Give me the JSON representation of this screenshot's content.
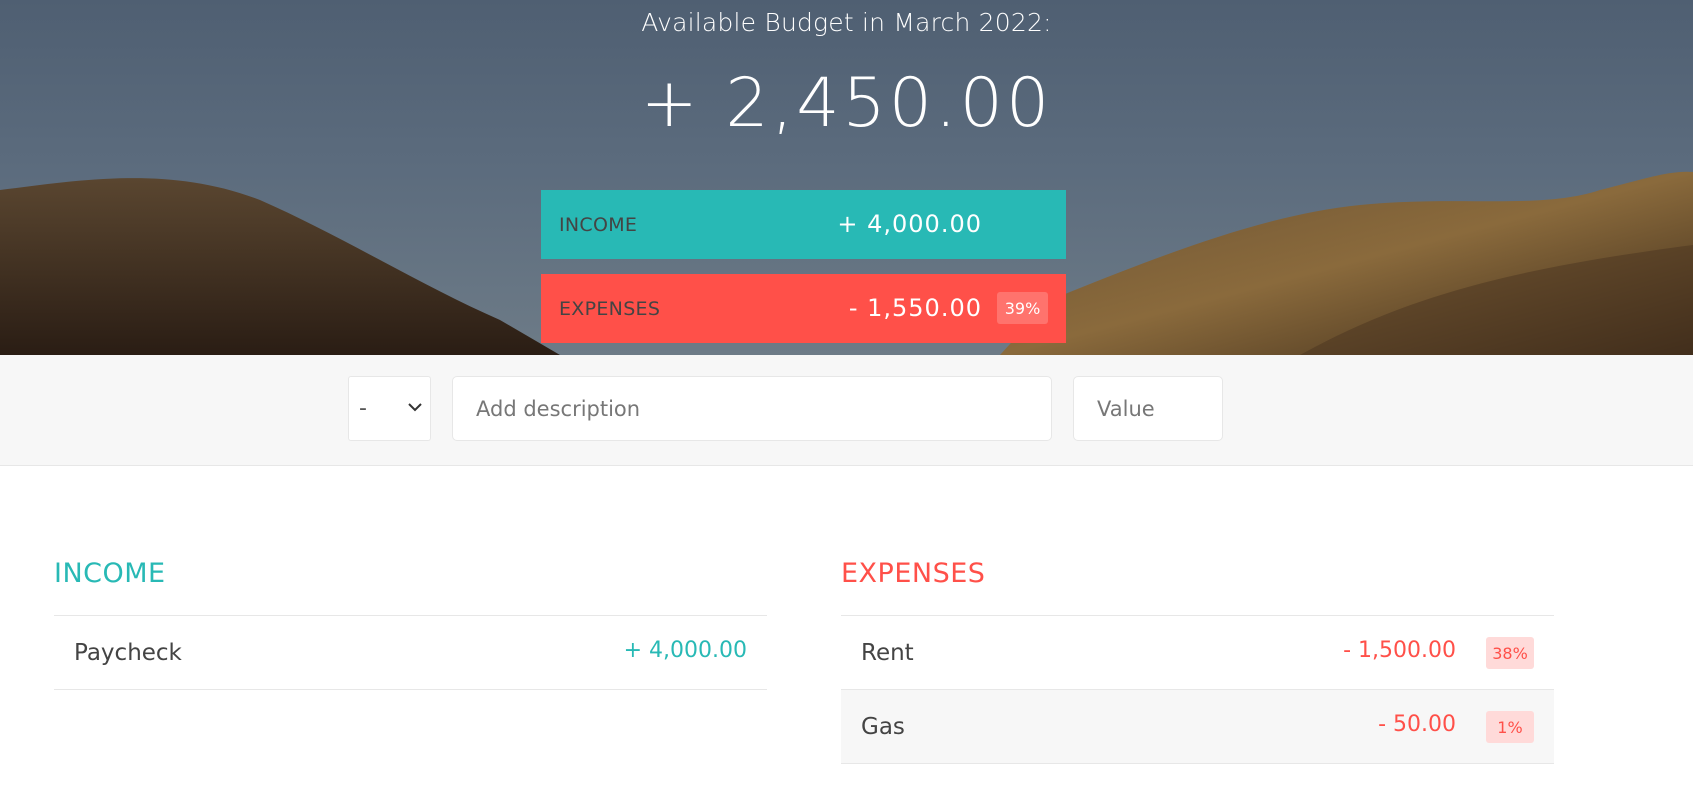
{
  "budget": {
    "title": "Available Budget in March 2022:",
    "value": "+ 2,450.00",
    "income_label": "INCOME",
    "income_value": "+ 4,000.00",
    "expenses_label": "EXPENSES",
    "expenses_value": "- 1,550.00",
    "expenses_percentage": "39%"
  },
  "add_form": {
    "type_value": "-",
    "description_placeholder": "Add description",
    "value_placeholder": "Value"
  },
  "income": {
    "title": "INCOME",
    "items": [
      {
        "description": "Paycheck",
        "value": "+ 4,000.00"
      }
    ]
  },
  "expenses": {
    "title": "EXPENSES",
    "items": [
      {
        "description": "Rent",
        "value": "- 1,500.00",
        "percentage": "38%"
      },
      {
        "description": "Gas",
        "value": "- 50.00",
        "percentage": "1%"
      }
    ]
  },
  "colors": {
    "income": "#28b9b5",
    "expenses": "#ff5049",
    "background_panel": "#f7f7f7"
  }
}
